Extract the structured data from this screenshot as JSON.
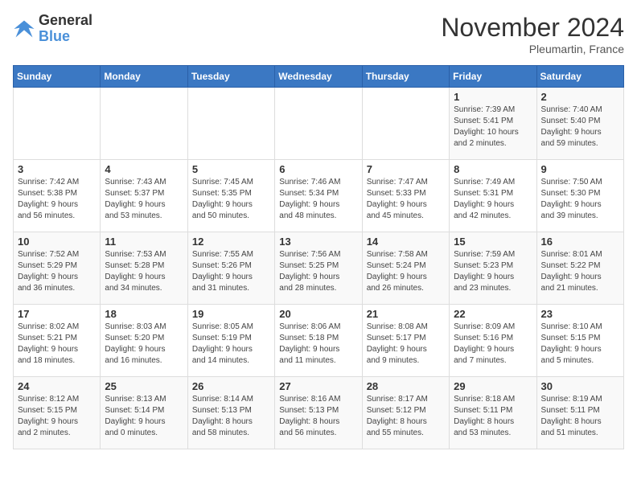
{
  "header": {
    "logo_line1": "General",
    "logo_line2": "Blue",
    "title": "November 2024",
    "subtitle": "Pleumartin, France"
  },
  "days_of_week": [
    "Sunday",
    "Monday",
    "Tuesday",
    "Wednesday",
    "Thursday",
    "Friday",
    "Saturday"
  ],
  "weeks": [
    [
      {
        "day": "",
        "info": ""
      },
      {
        "day": "",
        "info": ""
      },
      {
        "day": "",
        "info": ""
      },
      {
        "day": "",
        "info": ""
      },
      {
        "day": "",
        "info": ""
      },
      {
        "day": "1",
        "info": "Sunrise: 7:39 AM\nSunset: 5:41 PM\nDaylight: 10 hours\nand 2 minutes."
      },
      {
        "day": "2",
        "info": "Sunrise: 7:40 AM\nSunset: 5:40 PM\nDaylight: 9 hours\nand 59 minutes."
      }
    ],
    [
      {
        "day": "3",
        "info": "Sunrise: 7:42 AM\nSunset: 5:38 PM\nDaylight: 9 hours\nand 56 minutes."
      },
      {
        "day": "4",
        "info": "Sunrise: 7:43 AM\nSunset: 5:37 PM\nDaylight: 9 hours\nand 53 minutes."
      },
      {
        "day": "5",
        "info": "Sunrise: 7:45 AM\nSunset: 5:35 PM\nDaylight: 9 hours\nand 50 minutes."
      },
      {
        "day": "6",
        "info": "Sunrise: 7:46 AM\nSunset: 5:34 PM\nDaylight: 9 hours\nand 48 minutes."
      },
      {
        "day": "7",
        "info": "Sunrise: 7:47 AM\nSunset: 5:33 PM\nDaylight: 9 hours\nand 45 minutes."
      },
      {
        "day": "8",
        "info": "Sunrise: 7:49 AM\nSunset: 5:31 PM\nDaylight: 9 hours\nand 42 minutes."
      },
      {
        "day": "9",
        "info": "Sunrise: 7:50 AM\nSunset: 5:30 PM\nDaylight: 9 hours\nand 39 minutes."
      }
    ],
    [
      {
        "day": "10",
        "info": "Sunrise: 7:52 AM\nSunset: 5:29 PM\nDaylight: 9 hours\nand 36 minutes."
      },
      {
        "day": "11",
        "info": "Sunrise: 7:53 AM\nSunset: 5:28 PM\nDaylight: 9 hours\nand 34 minutes."
      },
      {
        "day": "12",
        "info": "Sunrise: 7:55 AM\nSunset: 5:26 PM\nDaylight: 9 hours\nand 31 minutes."
      },
      {
        "day": "13",
        "info": "Sunrise: 7:56 AM\nSunset: 5:25 PM\nDaylight: 9 hours\nand 28 minutes."
      },
      {
        "day": "14",
        "info": "Sunrise: 7:58 AM\nSunset: 5:24 PM\nDaylight: 9 hours\nand 26 minutes."
      },
      {
        "day": "15",
        "info": "Sunrise: 7:59 AM\nSunset: 5:23 PM\nDaylight: 9 hours\nand 23 minutes."
      },
      {
        "day": "16",
        "info": "Sunrise: 8:01 AM\nSunset: 5:22 PM\nDaylight: 9 hours\nand 21 minutes."
      }
    ],
    [
      {
        "day": "17",
        "info": "Sunrise: 8:02 AM\nSunset: 5:21 PM\nDaylight: 9 hours\nand 18 minutes."
      },
      {
        "day": "18",
        "info": "Sunrise: 8:03 AM\nSunset: 5:20 PM\nDaylight: 9 hours\nand 16 minutes."
      },
      {
        "day": "19",
        "info": "Sunrise: 8:05 AM\nSunset: 5:19 PM\nDaylight: 9 hours\nand 14 minutes."
      },
      {
        "day": "20",
        "info": "Sunrise: 8:06 AM\nSunset: 5:18 PM\nDaylight: 9 hours\nand 11 minutes."
      },
      {
        "day": "21",
        "info": "Sunrise: 8:08 AM\nSunset: 5:17 PM\nDaylight: 9 hours\nand 9 minutes."
      },
      {
        "day": "22",
        "info": "Sunrise: 8:09 AM\nSunset: 5:16 PM\nDaylight: 9 hours\nand 7 minutes."
      },
      {
        "day": "23",
        "info": "Sunrise: 8:10 AM\nSunset: 5:15 PM\nDaylight: 9 hours\nand 5 minutes."
      }
    ],
    [
      {
        "day": "24",
        "info": "Sunrise: 8:12 AM\nSunset: 5:15 PM\nDaylight: 9 hours\nand 2 minutes."
      },
      {
        "day": "25",
        "info": "Sunrise: 8:13 AM\nSunset: 5:14 PM\nDaylight: 9 hours\nand 0 minutes."
      },
      {
        "day": "26",
        "info": "Sunrise: 8:14 AM\nSunset: 5:13 PM\nDaylight: 8 hours\nand 58 minutes."
      },
      {
        "day": "27",
        "info": "Sunrise: 8:16 AM\nSunset: 5:13 PM\nDaylight: 8 hours\nand 56 minutes."
      },
      {
        "day": "28",
        "info": "Sunrise: 8:17 AM\nSunset: 5:12 PM\nDaylight: 8 hours\nand 55 minutes."
      },
      {
        "day": "29",
        "info": "Sunrise: 8:18 AM\nSunset: 5:11 PM\nDaylight: 8 hours\nand 53 minutes."
      },
      {
        "day": "30",
        "info": "Sunrise: 8:19 AM\nSunset: 5:11 PM\nDaylight: 8 hours\nand 51 minutes."
      }
    ]
  ]
}
